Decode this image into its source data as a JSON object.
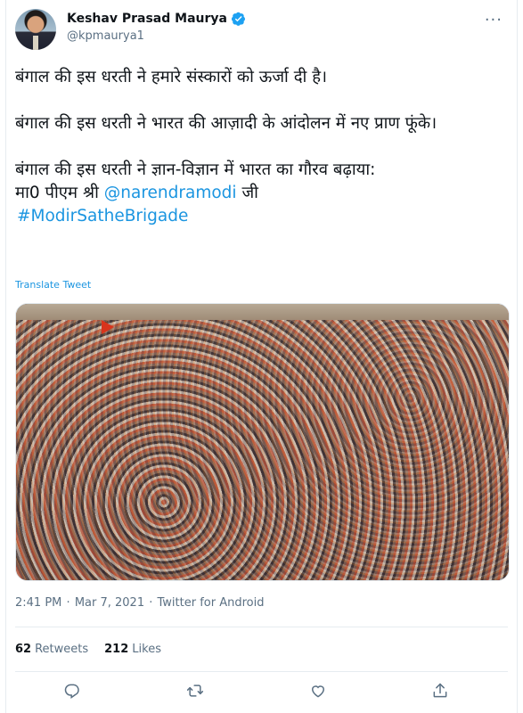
{
  "user": {
    "display_name": "Keshav Prasad Maurya",
    "handle": "@kpmaurya1"
  },
  "tweet": {
    "para1": "बंगाल की इस धरती ने हमारे संस्कारों को ऊर्जा दी है।",
    "para2": "बंगाल की इस धरती ने भारत की आज़ादी के आंदोलन में नए प्राण फूंके।",
    "para3_line1": "बंगाल की इस धरती ने ज्ञान-विज्ञान में भारत का गौरव बढ़ाया:",
    "para3_prefix": "मा0 पीएम श्री",
    "mention": "@narendramodi",
    "para3_suffix": "जी",
    "hashtag": "#ModirSatheBrigade",
    "translate_label": "Translate Tweet"
  },
  "meta": {
    "time": "2:41 PM",
    "date": "Mar 7, 2021",
    "source": "Twitter for Android",
    "separator": "·"
  },
  "stats": {
    "retweets_count": "62",
    "retweets_label": "Retweets",
    "likes_count": "212",
    "likes_label": "Likes"
  },
  "colors": {
    "link": "#1b95e0",
    "secondary_text": "#5b7083",
    "verified": "#1da1f2"
  },
  "icons": [
    "verified-badge-icon",
    "more-icon",
    "reply-icon",
    "retweet-icon",
    "like-icon",
    "share-icon"
  ]
}
